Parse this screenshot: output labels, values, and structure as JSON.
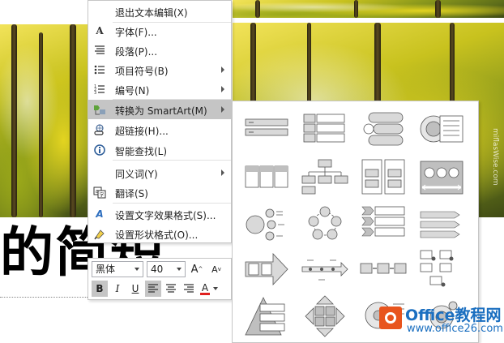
{
  "slide": {
    "title": "的简短",
    "side_watermark": "miflasWise.com"
  },
  "context_menu": {
    "items": [
      {
        "label": "退出文本编辑(X)",
        "icon": "",
        "submenu": false
      },
      {
        "label": "字体(F)...",
        "icon": "A",
        "submenu": false
      },
      {
        "label": "段落(P)...",
        "icon": "paragraph-icon",
        "submenu": false
      },
      {
        "label": "项目符号(B)",
        "icon": "bullets-icon",
        "submenu": true
      },
      {
        "label": "编号(N)",
        "icon": "numbering-icon",
        "submenu": true
      },
      {
        "label": "转换为 SmartArt(M)",
        "icon": "smartart-icon",
        "submenu": true,
        "highlighted": true
      },
      {
        "label": "超链接(H)...",
        "icon": "hyperlink-icon",
        "submenu": false
      },
      {
        "label": "智能查找(L)",
        "icon": "smart-lookup-icon",
        "submenu": false
      },
      {
        "label": "同义词(Y)",
        "icon": "",
        "submenu": true
      },
      {
        "label": "翻译(S)",
        "icon": "translate-icon",
        "submenu": false
      },
      {
        "label": "设置文字效果格式(S)...",
        "icon": "text-effects-icon",
        "submenu": false
      },
      {
        "label": "设置形状格式(O)...",
        "icon": "shape-format-icon",
        "submenu": false
      }
    ]
  },
  "mini_toolbar": {
    "font_name": "黑体",
    "font_size": "40",
    "grow_font": "A",
    "shrink_font": "A",
    "bold": "B",
    "italic": "I",
    "underline": "U",
    "font_color": "A",
    "font_color_value": "#e0201f"
  },
  "smartart_gallery": {
    "layouts": [
      "basic-block-list",
      "vertical-bullet-list",
      "vertical-circle-list",
      "target-list",
      "horizontal-bullet-list",
      "hierarchy",
      "grouped-list",
      "picture-list",
      "basic-radial",
      "basic-cycle",
      "chevron-list",
      "arrow-list",
      "basic-process",
      "horizontal-timeline",
      "linear-process",
      "bending-process",
      "pyramid-list",
      "matrix",
      "circle-picture",
      "converging-radial"
    ]
  },
  "watermark": {
    "brand": "Office教程网",
    "url": "www.office26.com",
    "accent": "#e8541d",
    "text_color": "#1b6fc0"
  }
}
